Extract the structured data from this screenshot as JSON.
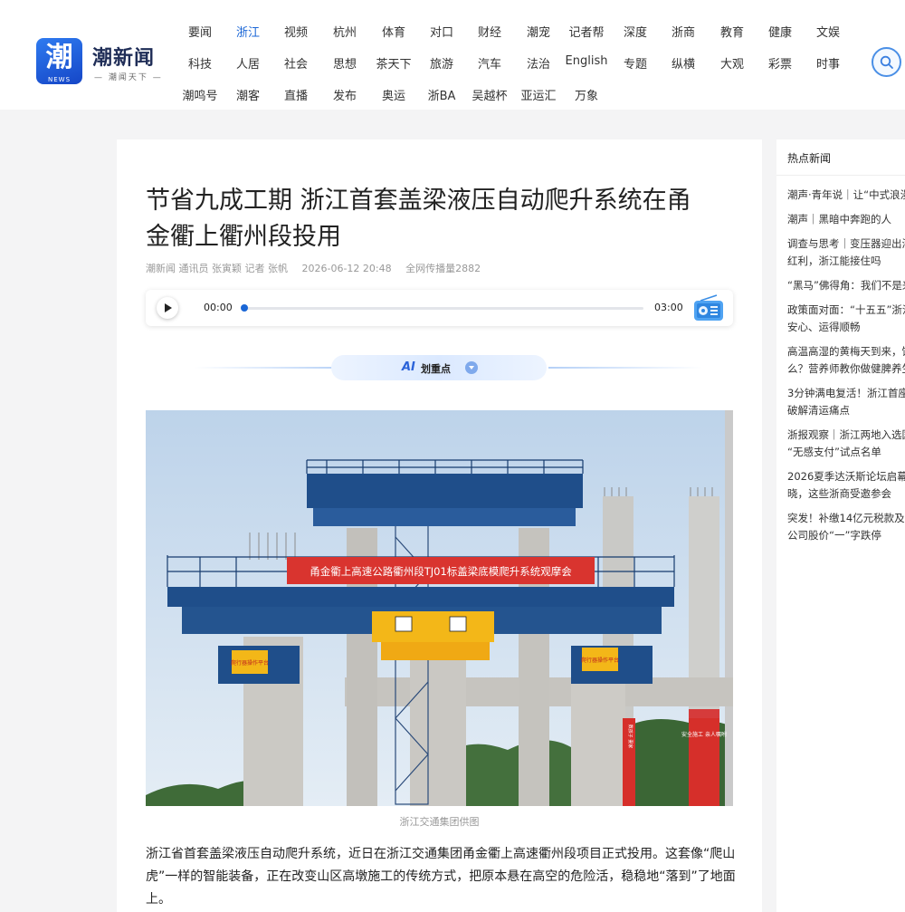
{
  "header": {
    "logo_char": "潮",
    "logo_en": "NEWS",
    "logo_name": "潮新闻",
    "logo_slogan": "— 潮闻天下 —",
    "nav_rows": [
      [
        "要闻",
        "浙江",
        "视频",
        "杭州",
        "体育",
        "对口",
        "财经",
        "潮宠",
        "记者帮",
        "深度",
        "浙商",
        "教育",
        "健康",
        "文娱"
      ],
      [
        "科技",
        "人居",
        "社会",
        "思想",
        "茶天下",
        "旅游",
        "汽车",
        "法治",
        "English",
        "专题",
        "纵横",
        "大观",
        "彩票",
        "时事"
      ],
      [
        "潮鸣号",
        "潮客",
        "直播",
        "发布",
        "奥运",
        "浙BA",
        "吴越杯",
        "亚运汇",
        "万象"
      ]
    ],
    "active_nav": "浙江"
  },
  "article": {
    "title_line1": "节省九成工期 浙江首套盖梁液压自动爬升系统在甬",
    "title_line2": "金衢上衢州段投用",
    "source": "潮新闻 通讯员 张寅颖 记者 张帆",
    "datetime": "2026-06-12 20:48",
    "views": "全网传播量2882",
    "audio": {
      "current": "00:00",
      "total": "03:00",
      "progress": 0
    },
    "ai_logo": "AI",
    "ai_label": "划重点",
    "photo": {
      "banner": "甬金衢上高速公路衢州段TJ01标盖梁底模爬升系统观摩会",
      "sign_small": "爬行器操作平台",
      "pillar_sign_1": "安全施工 亲人嘱咐",
      "pillar_sign_2": "数孩子 妻家"
    },
    "caption": "浙江交通集团供图",
    "body": "浙江省首套盖梁液压自动爬升系统，近日在浙江交通集团甬金衢上高速衢州段项目正式投用。这套像“爬山虎”一样的智能装备，正在改变山区高墩施工的传统方式，把原本悬在高空的危险活，稳稳地“落到”了地面上。"
  },
  "sidebar": {
    "title": "热点新闻",
    "items": [
      "潮声·青年说｜让“中式浪漫",
      "潮声｜黑暗中奔跑的人",
      "调查与思考｜变压器迎出海",
      "红利，浙江能接住吗",
      "“黑马”佛得角：我们不是来",
      "政策面对面：“十五五”浙江",
      "安心、运得顺畅",
      "高温高湿的黄梅天到来，饮",
      "么？营养师教你做健脾养生",
      "3分钟满电复活！浙江首座",
      "破解清运痛点",
      "浙报观察｜浙江两地入选国",
      "“无感支付”试点名单",
      "2026夏季达沃斯论坛启幕：",
      "晓，这些浙商受邀参会",
      "突发！补缴14亿元税款及滞",
      "公司股价“一”字跌停"
    ]
  }
}
